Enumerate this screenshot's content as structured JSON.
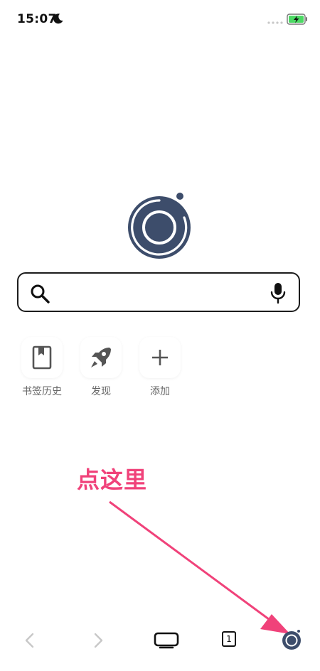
{
  "status_bar": {
    "time": "15:07",
    "icons": [
      "moon-icon",
      "signal-dots",
      "battery-charging-icon"
    ],
    "battery_color": "#4cd964"
  },
  "search": {
    "placeholder": "",
    "icons": [
      "search-icon",
      "microphone-icon"
    ]
  },
  "shortcuts": [
    {
      "label": "书签历史",
      "icon": "bookmark-icon"
    },
    {
      "label": "发现",
      "icon": "rocket-icon"
    },
    {
      "label": "添加",
      "icon": "plus-icon"
    }
  ],
  "annotation": {
    "text": "点这里",
    "color": "#f0427a"
  },
  "toolbar": {
    "icons": [
      "back-icon",
      "forward-icon",
      "menu-icon",
      "tabs-icon",
      "home-logo-icon"
    ],
    "tab_count": "1"
  },
  "colors": {
    "logo": "#3d4d6b",
    "text_label": "#666666",
    "disabled": "#c8c8c8"
  }
}
